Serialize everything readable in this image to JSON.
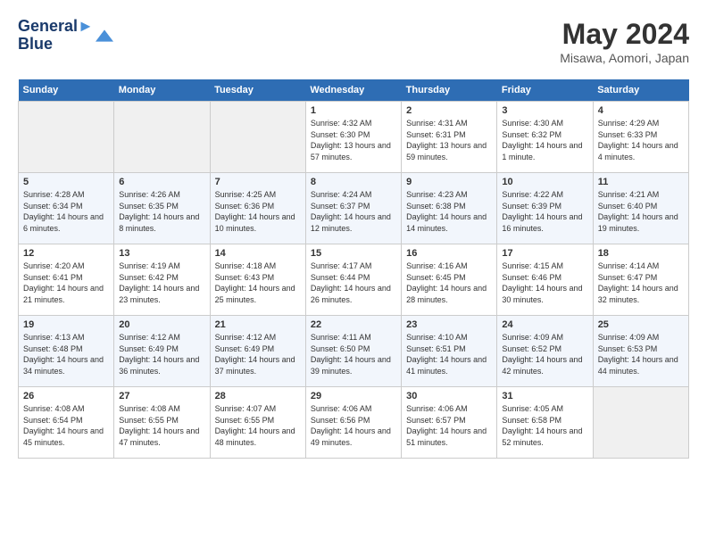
{
  "header": {
    "logo_line1": "General",
    "logo_line2": "Blue",
    "month": "May 2024",
    "location": "Misawa, Aomori, Japan"
  },
  "days_of_week": [
    "Sunday",
    "Monday",
    "Tuesday",
    "Wednesday",
    "Thursday",
    "Friday",
    "Saturday"
  ],
  "weeks": [
    [
      {
        "day": "",
        "empty": true
      },
      {
        "day": "",
        "empty": true
      },
      {
        "day": "",
        "empty": true
      },
      {
        "day": "1",
        "sunrise": "4:32 AM",
        "sunset": "6:30 PM",
        "daylight": "13 hours and 57 minutes."
      },
      {
        "day": "2",
        "sunrise": "4:31 AM",
        "sunset": "6:31 PM",
        "daylight": "13 hours and 59 minutes."
      },
      {
        "day": "3",
        "sunrise": "4:30 AM",
        "sunset": "6:32 PM",
        "daylight": "14 hours and 1 minute."
      },
      {
        "day": "4",
        "sunrise": "4:29 AM",
        "sunset": "6:33 PM",
        "daylight": "14 hours and 4 minutes."
      }
    ],
    [
      {
        "day": "5",
        "sunrise": "4:28 AM",
        "sunset": "6:34 PM",
        "daylight": "14 hours and 6 minutes."
      },
      {
        "day": "6",
        "sunrise": "4:26 AM",
        "sunset": "6:35 PM",
        "daylight": "14 hours and 8 minutes."
      },
      {
        "day": "7",
        "sunrise": "4:25 AM",
        "sunset": "6:36 PM",
        "daylight": "14 hours and 10 minutes."
      },
      {
        "day": "8",
        "sunrise": "4:24 AM",
        "sunset": "6:37 PM",
        "daylight": "14 hours and 12 minutes."
      },
      {
        "day": "9",
        "sunrise": "4:23 AM",
        "sunset": "6:38 PM",
        "daylight": "14 hours and 14 minutes."
      },
      {
        "day": "10",
        "sunrise": "4:22 AM",
        "sunset": "6:39 PM",
        "daylight": "14 hours and 16 minutes."
      },
      {
        "day": "11",
        "sunrise": "4:21 AM",
        "sunset": "6:40 PM",
        "daylight": "14 hours and 19 minutes."
      }
    ],
    [
      {
        "day": "12",
        "sunrise": "4:20 AM",
        "sunset": "6:41 PM",
        "daylight": "14 hours and 21 minutes."
      },
      {
        "day": "13",
        "sunrise": "4:19 AM",
        "sunset": "6:42 PM",
        "daylight": "14 hours and 23 minutes."
      },
      {
        "day": "14",
        "sunrise": "4:18 AM",
        "sunset": "6:43 PM",
        "daylight": "14 hours and 25 minutes."
      },
      {
        "day": "15",
        "sunrise": "4:17 AM",
        "sunset": "6:44 PM",
        "daylight": "14 hours and 26 minutes."
      },
      {
        "day": "16",
        "sunrise": "4:16 AM",
        "sunset": "6:45 PM",
        "daylight": "14 hours and 28 minutes."
      },
      {
        "day": "17",
        "sunrise": "4:15 AM",
        "sunset": "6:46 PM",
        "daylight": "14 hours and 30 minutes."
      },
      {
        "day": "18",
        "sunrise": "4:14 AM",
        "sunset": "6:47 PM",
        "daylight": "14 hours and 32 minutes."
      }
    ],
    [
      {
        "day": "19",
        "sunrise": "4:13 AM",
        "sunset": "6:48 PM",
        "daylight": "14 hours and 34 minutes."
      },
      {
        "day": "20",
        "sunrise": "4:12 AM",
        "sunset": "6:49 PM",
        "daylight": "14 hours and 36 minutes."
      },
      {
        "day": "21",
        "sunrise": "4:12 AM",
        "sunset": "6:49 PM",
        "daylight": "14 hours and 37 minutes."
      },
      {
        "day": "22",
        "sunrise": "4:11 AM",
        "sunset": "6:50 PM",
        "daylight": "14 hours and 39 minutes."
      },
      {
        "day": "23",
        "sunrise": "4:10 AM",
        "sunset": "6:51 PM",
        "daylight": "14 hours and 41 minutes."
      },
      {
        "day": "24",
        "sunrise": "4:09 AM",
        "sunset": "6:52 PM",
        "daylight": "14 hours and 42 minutes."
      },
      {
        "day": "25",
        "sunrise": "4:09 AM",
        "sunset": "6:53 PM",
        "daylight": "14 hours and 44 minutes."
      }
    ],
    [
      {
        "day": "26",
        "sunrise": "4:08 AM",
        "sunset": "6:54 PM",
        "daylight": "14 hours and 45 minutes."
      },
      {
        "day": "27",
        "sunrise": "4:08 AM",
        "sunset": "6:55 PM",
        "daylight": "14 hours and 47 minutes."
      },
      {
        "day": "28",
        "sunrise": "4:07 AM",
        "sunset": "6:55 PM",
        "daylight": "14 hours and 48 minutes."
      },
      {
        "day": "29",
        "sunrise": "4:06 AM",
        "sunset": "6:56 PM",
        "daylight": "14 hours and 49 minutes."
      },
      {
        "day": "30",
        "sunrise": "4:06 AM",
        "sunset": "6:57 PM",
        "daylight": "14 hours and 51 minutes."
      },
      {
        "day": "31",
        "sunrise": "4:05 AM",
        "sunset": "6:58 PM",
        "daylight": "14 hours and 52 minutes."
      },
      {
        "day": "",
        "empty": true
      }
    ]
  ]
}
